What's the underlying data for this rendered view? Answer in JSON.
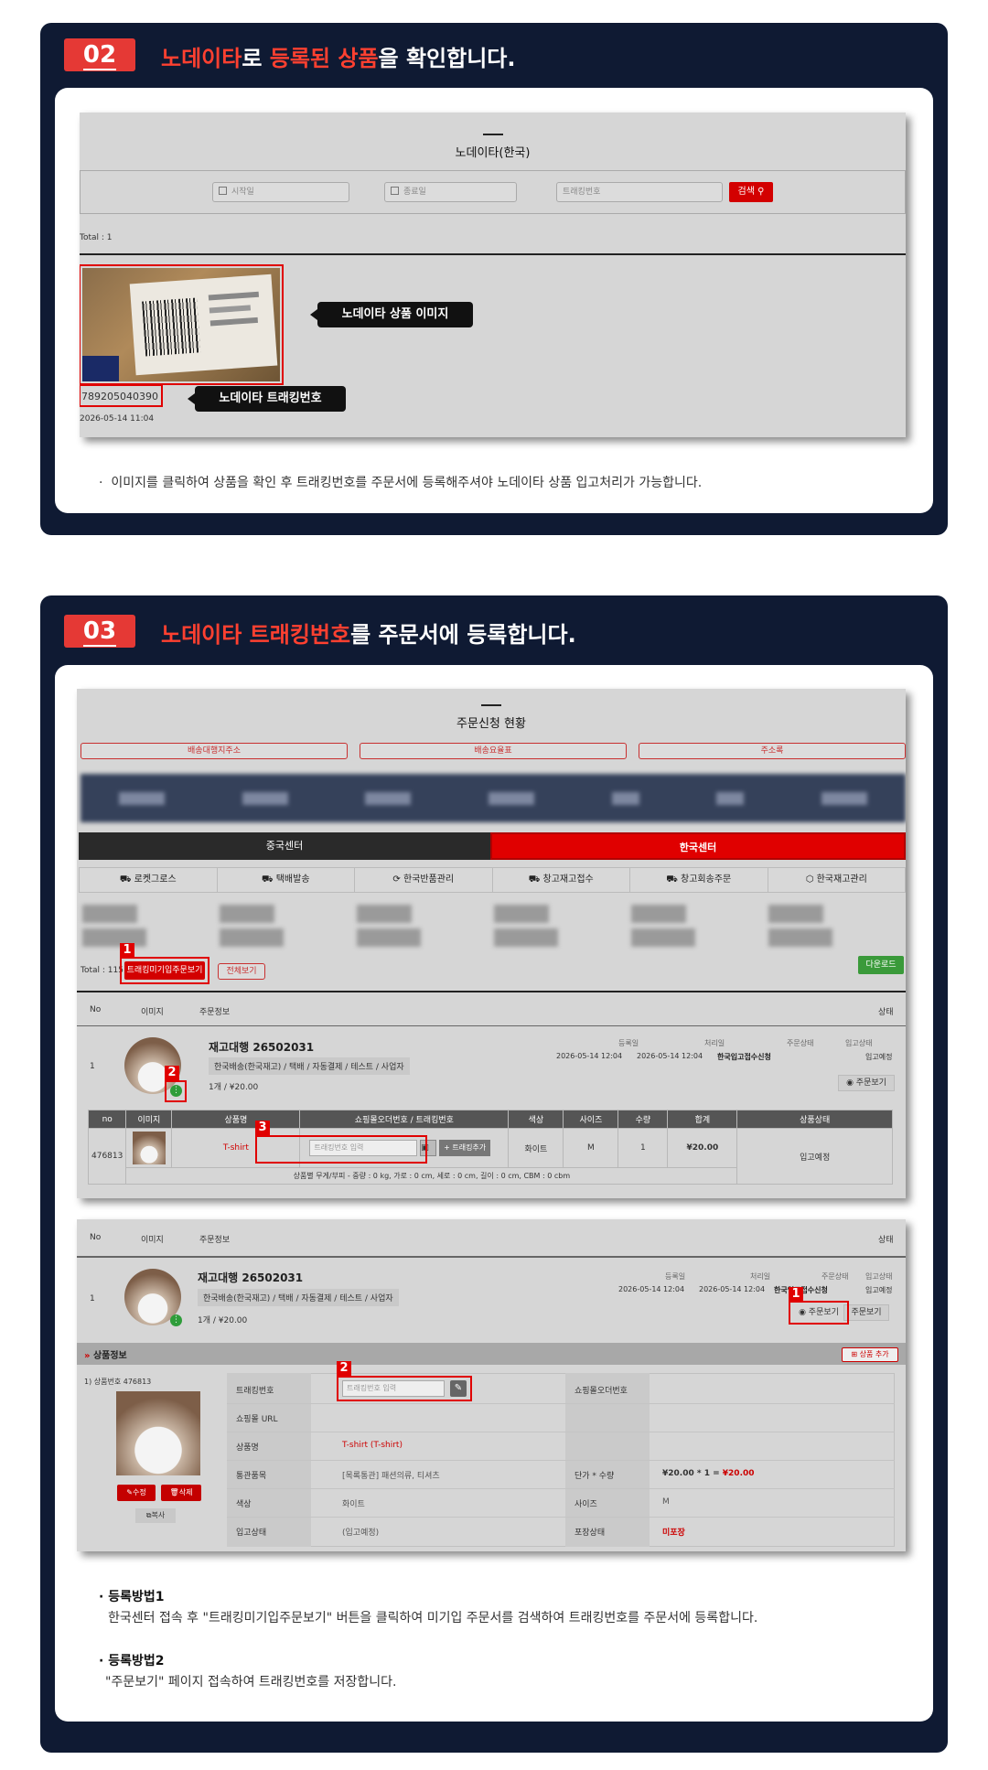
{
  "section02": {
    "num": "02",
    "head_p1": "노데이타",
    "head_p2": "로 ",
    "head_p3": "등록된 상품",
    "head_p4": "을 확인합니다.",
    "page_title": "노데이타(한국)",
    "start_placeholder": "시작일",
    "end_placeholder": "종료일",
    "tracking_placeholder": "트래킹번호",
    "search_label": "검색",
    "total": "Total : 1",
    "tracking_number": "789205040390",
    "date": "2026-05-14 11:04",
    "callout_image": "노데이타 상품 이미지",
    "callout_tracking": "노데이타 트래킹번호",
    "note": "이미지를 클릭하여 상품을 확인 후 트래킹번호를 주문서에 등록해주셔야 노데이타 상품 입고처리가 가능합니다."
  },
  "section03": {
    "num": "03",
    "head_p1": "노데이타 트래킹번호",
    "head_p2": "를 주문서에 등록합니다.",
    "page_title": "주문신청 현황",
    "top_buttons": [
      "배송대행지주소",
      "배송요율표",
      "주소록"
    ],
    "center_tabs": [
      "중국센터",
      "한국센터"
    ],
    "service_tabs": [
      "로켓그로스",
      "택배발송",
      "한국반품관리",
      "창고재고접수",
      "창고회송주문",
      "한국재고관리"
    ],
    "total": "Total : 115",
    "filter_btn": "트래킹미기입주문보기",
    "all_btn": "전체보기",
    "download_btn": "다운로드",
    "col_no": "No",
    "col_image": "이미지",
    "col_info": "주문정보",
    "col_status": "상태",
    "order": {
      "row_no": "1",
      "title": "재고대행 26502031",
      "tags": "한국배송(한국재고) / 택배 / 자동결제 / 테스트 / 사업자",
      "qty": "1개 / ¥20.00",
      "meta_labels": [
        "등록일",
        "처리일",
        "주문상태",
        "입고상태"
      ],
      "meta_values": [
        "2026-05-14 12:04",
        "2026-05-14 12:04",
        "한국입고접수신청",
        "입고예정"
      ],
      "view_btn": "주문보기"
    },
    "item_headers": [
      "no",
      "이미지",
      "상품명",
      "쇼핑몰오더번호 / 트래킹번호",
      "색상",
      "사이즈",
      "수량",
      "합계",
      "상품상태"
    ],
    "item": {
      "no": "476813",
      "name": "T-shirt",
      "tracking_placeholder": "트래킹번호 입력",
      "tracking_add": "+ 트래킹추가",
      "color": "화이트",
      "size": "M",
      "qty": "1",
      "total": "¥20.00",
      "status": "입고예정",
      "dims": "상품별 무게/부피 - 중량 : 0 kg, 가로 : 0 cm, 세로 : 0 cm, 길이 : 0 cm, CBM : 0 cbm"
    },
    "detail": {
      "section_title": "상품정보",
      "add_btn": "상품 추가",
      "item_no_label": "1) 상품번호 476813",
      "edit_btn": "수정",
      "delete_btn": "삭제",
      "copy_btn": "복사",
      "labels": [
        "트래킹번호",
        "쇼핑몰 URL",
        "상품명",
        "통관품목",
        "색상",
        "입고상태"
      ],
      "tracking_placeholder": "트래킹번호 입력",
      "mall_order_label": "쇼핑몰오더번호",
      "product_name": "T-shirt (T-shirt)",
      "customs": "[목록통관] 패션의류, 티셔츠",
      "price_label": "단가 * 수량",
      "price_a": "¥20.00",
      "price_op": " * 1 = ",
      "price_total": "¥20.00",
      "color": "화이트",
      "size_label": "사이즈",
      "size": "M",
      "stock_status": "(입고예정)",
      "pack_label": "포장상태",
      "pack_value": "미포장"
    },
    "marker_1": "1",
    "marker_2": "2",
    "marker_3": "3",
    "method1_title": "· 등록방법1",
    "method1_text": "한국센터 접속 후 \"트래킹미기입주문보기\" 버튼을 클릭하여 미기입 주문서를 검색하여 트래킹번호를 주문서에 등록합니다.",
    "method2_title": "· 등록방법2",
    "method2_text": "\"주문보기\" 페이지 접속하여 트래킹번호를 저장합니다."
  }
}
